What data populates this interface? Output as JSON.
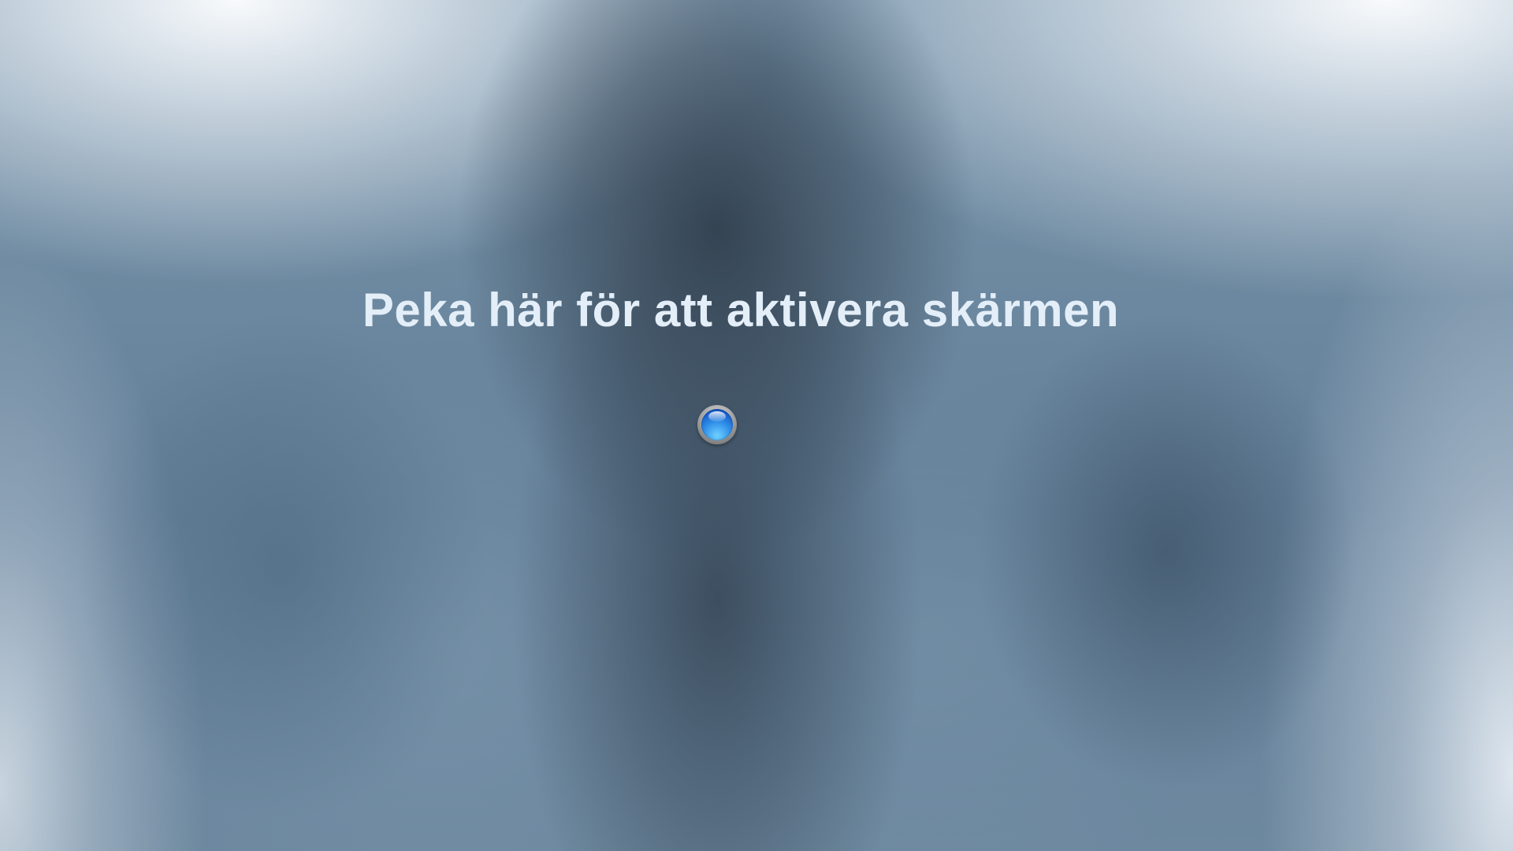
{
  "screen": {
    "prompt_text": "Peka här för att aktivera skärmen",
    "activate_button": {
      "icon": "blue-orb-icon",
      "accent_color": "#2f8fe8"
    }
  }
}
